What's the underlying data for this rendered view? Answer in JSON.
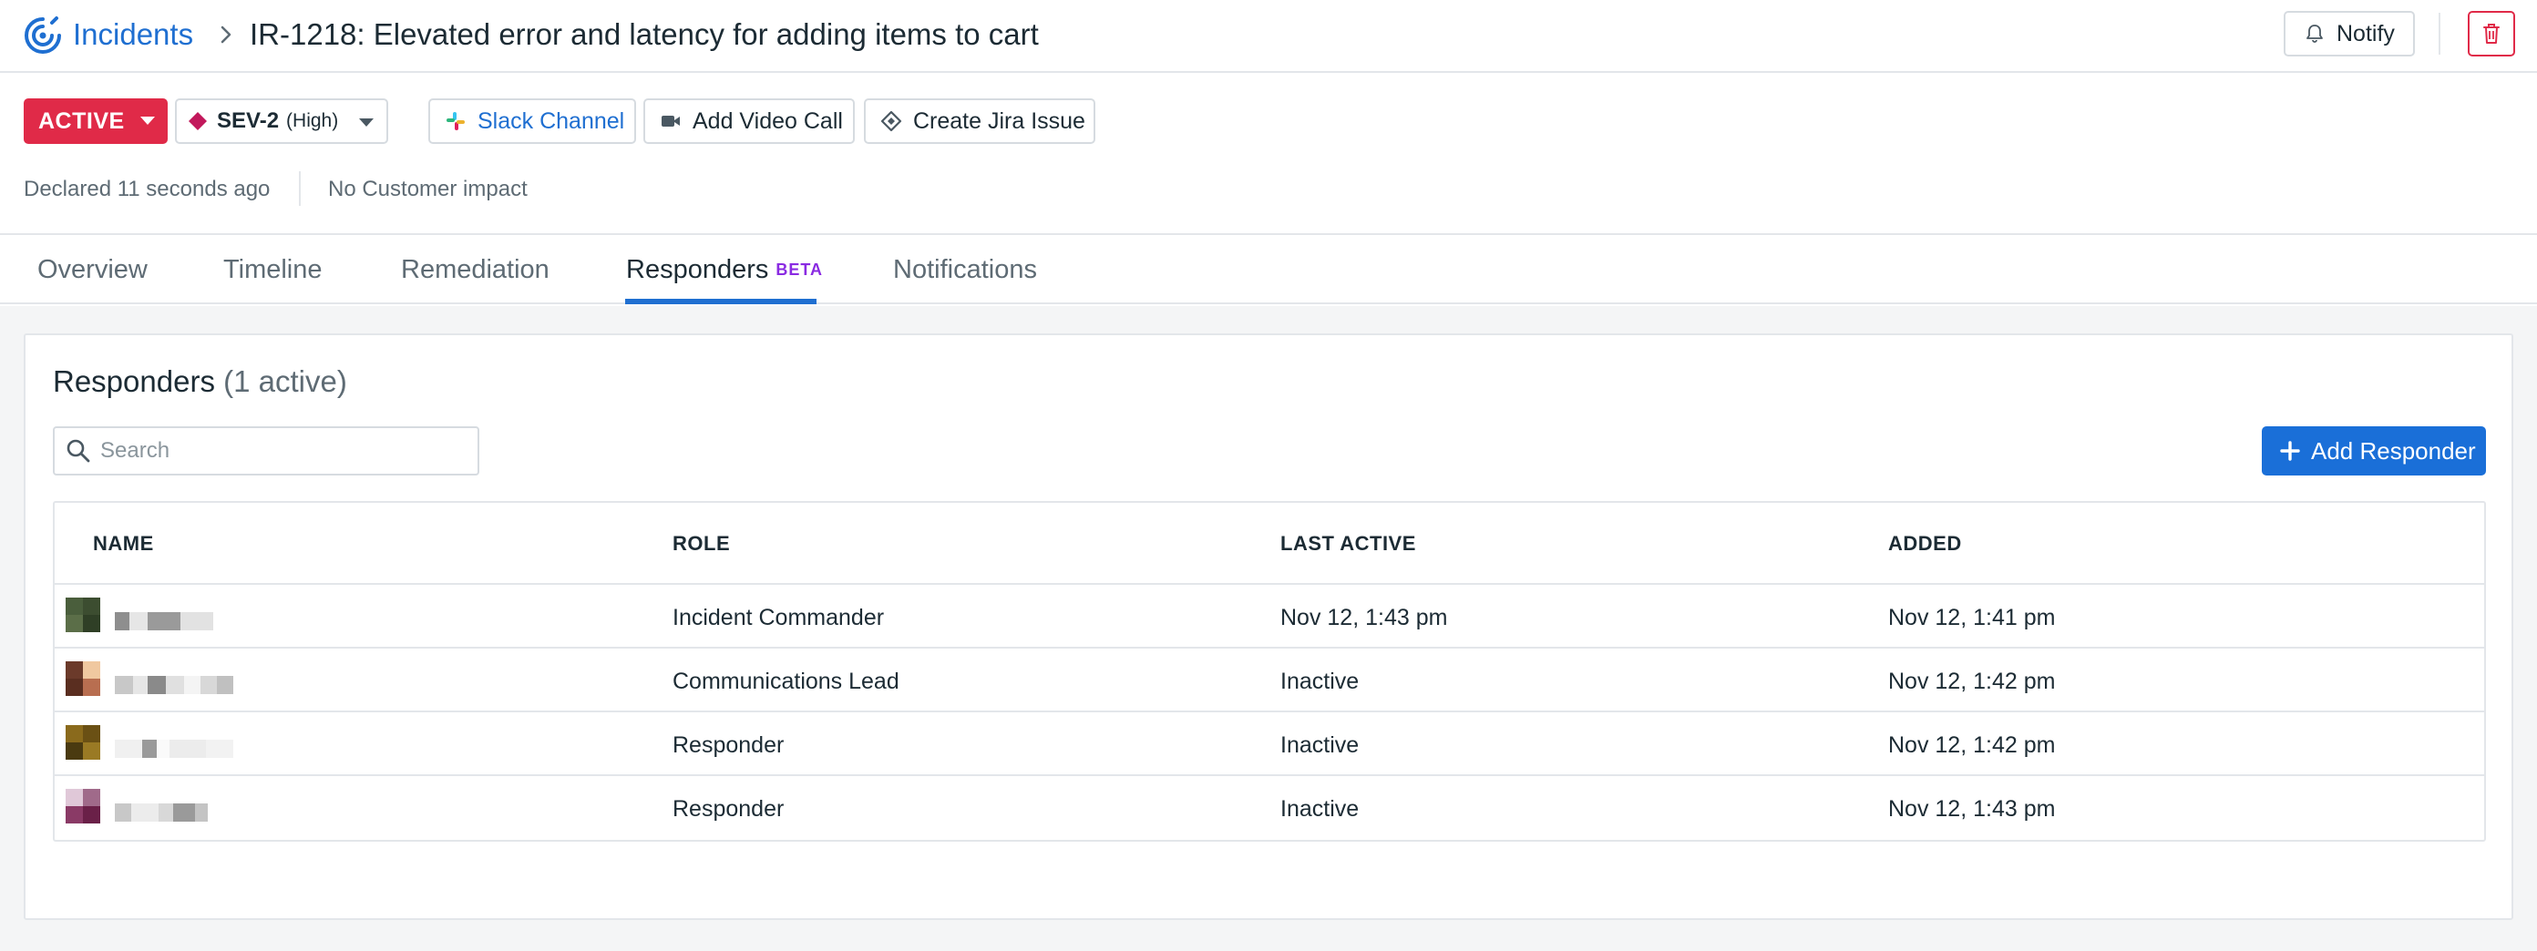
{
  "header": {
    "breadcrumb_link": "Incidents",
    "title": "IR-1218:  Elevated error and latency for adding items to cart",
    "notify_label": "Notify"
  },
  "status": {
    "state_label": "ACTIVE",
    "severity_label": "SEV-2",
    "severity_sub": "(High)",
    "severity_color": "#c2185b"
  },
  "actions": {
    "slack_label": "Slack Channel",
    "video_label": "Add Video Call",
    "jira_label": "Create Jira Issue"
  },
  "meta": {
    "declared": "Declared 11 seconds ago",
    "impact": "No Customer impact"
  },
  "tabs": [
    {
      "label": "Overview"
    },
    {
      "label": "Timeline"
    },
    {
      "label": "Remediation"
    },
    {
      "label": "Responders",
      "badge": "BETA",
      "active": true
    },
    {
      "label": "Notifications"
    }
  ],
  "panel": {
    "title": "Responders",
    "count": "(1 active)",
    "search_placeholder": "Search",
    "add_button_label": "Add Responder"
  },
  "table": {
    "columns": [
      "NAME",
      "ROLE",
      "LAST ACTIVE",
      "ADDED"
    ],
    "rows": [
      {
        "role": "Incident Commander",
        "last_active": "Nov 12, 1:43 pm",
        "added": "Nov 12, 1:41 pm"
      },
      {
        "role": "Communications Lead",
        "last_active": "Inactive",
        "added": "Nov 12, 1:42 pm"
      },
      {
        "role": "Responder",
        "last_active": "Inactive",
        "added": "Nov 12, 1:42 pm"
      },
      {
        "role": "Responder",
        "last_active": "Inactive",
        "added": "Nov 12, 1:43 pm"
      }
    ]
  },
  "colors": {
    "accent_blue": "#1f6fd1",
    "danger_red": "#e02a48",
    "beta_purple": "#8a2be2"
  }
}
